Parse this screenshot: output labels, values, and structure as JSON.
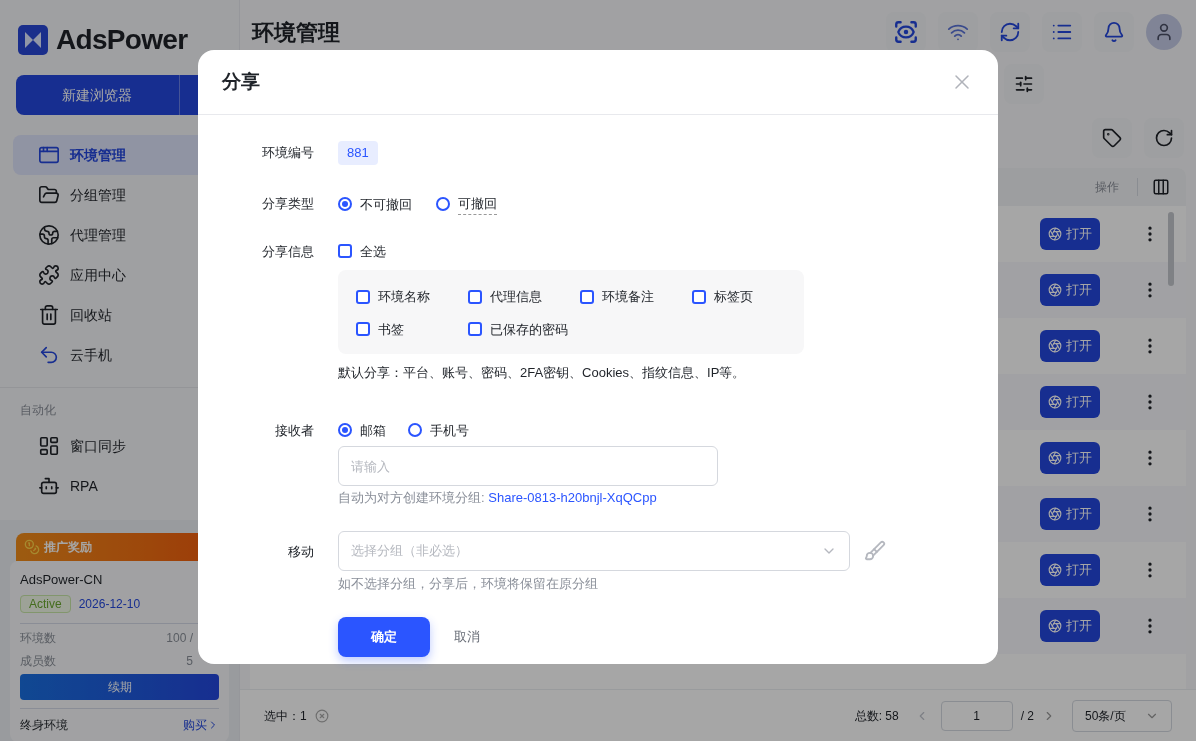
{
  "sidebar": {
    "logo": "AdsPower",
    "new_button": "新建浏览器",
    "nav": [
      {
        "label": "环境管理",
        "selected": true
      },
      {
        "label": "分组管理",
        "selected": false
      },
      {
        "label": "代理管理",
        "selected": false
      },
      {
        "label": "应用中心",
        "selected": false
      },
      {
        "label": "回收站",
        "selected": false
      },
      {
        "label": "云手机",
        "selected": false
      }
    ],
    "section": "自动化",
    "automation": [
      {
        "label": "窗口同步",
        "selected": false
      },
      {
        "label": "RPA",
        "selected": false
      }
    ],
    "promo": {
      "banner": "推广奖励",
      "account": "AdsPower-CN",
      "status": "Active",
      "expiry": "2026-12-10",
      "stats": [
        {
          "label": "环境数",
          "value": "100 /"
        },
        {
          "label": "成员数",
          "value": "5"
        }
      ],
      "renew": "续期",
      "lifetime": "终身环境",
      "buy": "购买"
    }
  },
  "page": {
    "title": "环境管理"
  },
  "table": {
    "columns": [
      "操作"
    ],
    "rows": [
      {
        "action": "打开"
      },
      {
        "action": "打开"
      },
      {
        "action": "打开"
      },
      {
        "action": "打开"
      },
      {
        "action": "打开"
      },
      {
        "action": "打开"
      },
      {
        "action": "打开"
      },
      {
        "action": "打开"
      }
    ]
  },
  "footer": {
    "selected": "选中：1",
    "total": "总数: 58",
    "page": "1",
    "pages": "/ 2",
    "page_size": "50条/页"
  },
  "dialog": {
    "title": "分享",
    "env_id": {
      "label": "环境编号",
      "value": "881"
    },
    "share_type": {
      "label": "分享类型",
      "options": [
        {
          "label": "不可撤回",
          "selected": true,
          "has_tooltip": false
        },
        {
          "label": "可撤回",
          "selected": false,
          "has_tooltip": true
        }
      ]
    },
    "share_info": {
      "label": "分享信息",
      "select_all": {
        "label": "全选",
        "checked": false
      },
      "items": [
        {
          "label": "环境名称",
          "checked": false
        },
        {
          "label": "代理信息",
          "checked": false
        },
        {
          "label": "环境备注",
          "checked": false
        },
        {
          "label": "标签页",
          "checked": false
        },
        {
          "label": "书签",
          "checked": false
        },
        {
          "label": "已保存的密码",
          "checked": false
        }
      ],
      "note": "默认分享：平台、账号、密码、2FA密钥、Cookies、指纹信息、IP等。"
    },
    "receiver": {
      "label": "接收者",
      "options": [
        {
          "label": "邮箱",
          "selected": true,
          "has_tooltip": false
        },
        {
          "label": "手机号",
          "selected": false,
          "has_tooltip": false
        }
      ],
      "placeholder": "请输入",
      "hint": "自动为对方创建环境分组:",
      "group_name": "Share-0813-h20bnjl-XqQCpp"
    },
    "move": {
      "label": "移动",
      "placeholder": "选择分组（非必选）",
      "hint": "如不选择分组，分享后，环境将保留在原分组"
    },
    "buttons": {
      "confirm": "确定",
      "cancel": "取消"
    }
  }
}
